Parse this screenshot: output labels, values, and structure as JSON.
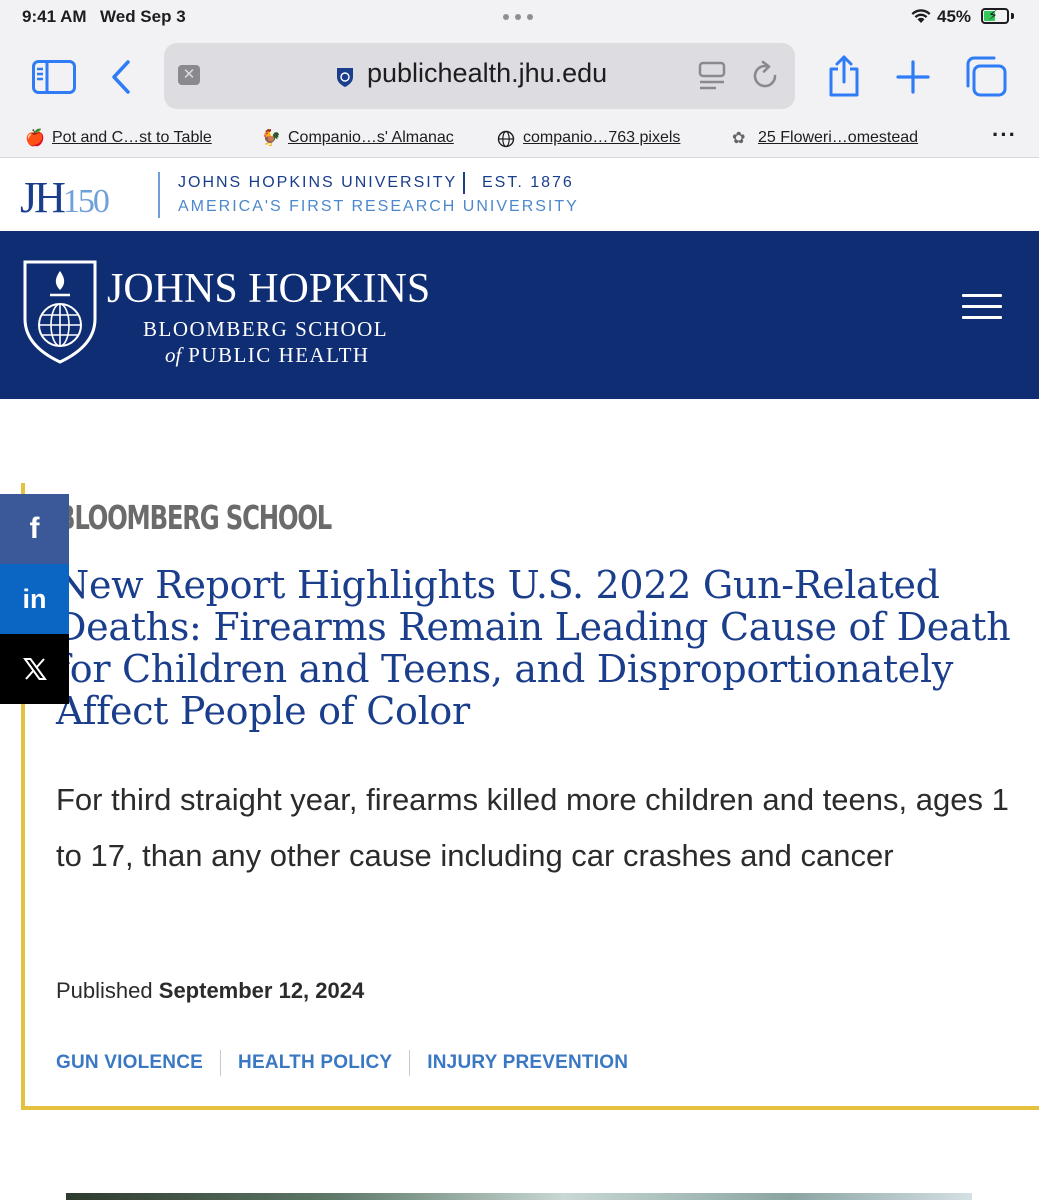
{
  "status_bar": {
    "time": "9:41 AM",
    "date": "Wed Sep 3",
    "battery": "45%",
    "battery_level": 0.45
  },
  "browser": {
    "url": "publichealth.jhu.edu",
    "bookmarks": [
      {
        "label": "Pot and C…st to Table",
        "icon": "apple-icon"
      },
      {
        "label": "Companio…s' Almanac",
        "icon": "rooster-icon"
      },
      {
        "label": "companio…763 pixels",
        "icon": "globe-icon"
      },
      {
        "label": "25 Floweri…omestead",
        "icon": "flower-icon"
      }
    ]
  },
  "jhu_strip": {
    "logo_letters": "JH",
    "logo_number": "150",
    "name": "JOHNS HOPKINS UNIVERSITY",
    "est": "EST. 1876",
    "tagline": "AMERICA'S FIRST RESEARCH UNIVERSITY"
  },
  "site_header": {
    "title": "JOHNS HOPKINS",
    "sub1": "BLOOMBERG SCHOOL",
    "sub2_prefix": "of",
    "sub2": "PUBLIC HEALTH"
  },
  "article": {
    "eyebrow": "BLOOMBERG SCHOOL",
    "headline": "New Report Highlights U.S. 2022 Gun-Related Deaths: Firearms Remain Leading Cause of Death for Children and Teens, and Disproportionately Affect People of Color",
    "subhead": "For third straight year, firearms killed more children and teens, ages 1 to 17, than any other cause including car crashes and cancer",
    "published_label": "Published",
    "published_date": "September 12, 2024",
    "tags": [
      "GUN VIOLENCE",
      "HEALTH POLICY",
      "INJURY PREVENTION"
    ]
  },
  "share": {
    "facebook": "f",
    "linkedin": "in",
    "x": "𝕏"
  },
  "colors": {
    "brand_navy": "#0f2d73",
    "accent_gold": "#e6c13e",
    "headline_blue": "#1a3e8c",
    "tag_blue": "#3a78c4"
  }
}
